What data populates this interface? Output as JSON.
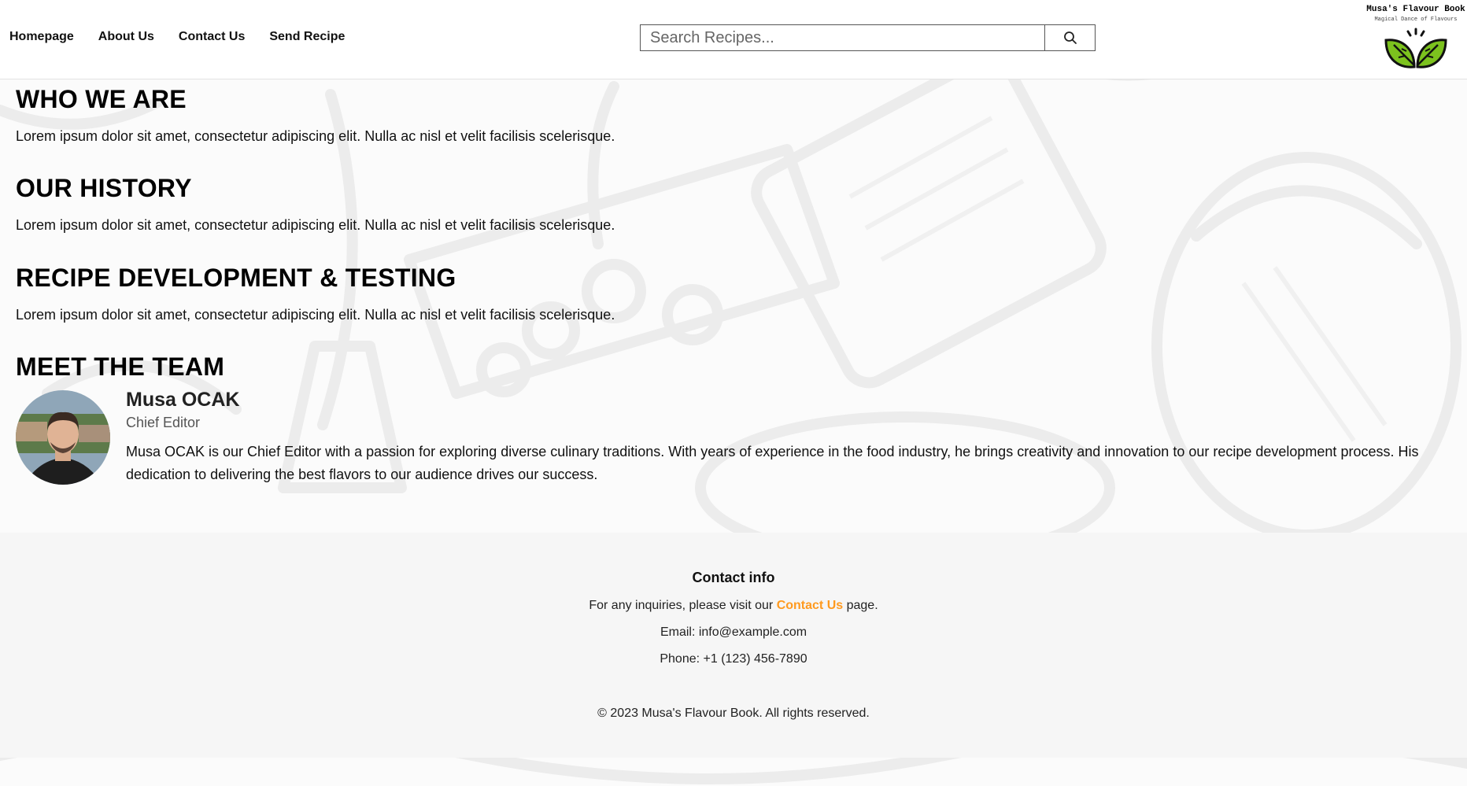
{
  "nav": {
    "items": [
      "Homepage",
      "About Us",
      "Contact Us",
      "Send Recipe"
    ]
  },
  "search": {
    "placeholder": "Search Recipes...",
    "icon": "search-icon"
  },
  "brand": {
    "title": "Musa's Flavour Book",
    "tagline": "Magical Dance of Flavours",
    "logo_icon": "leaf-logo-icon",
    "logo_color": "#7cc21e"
  },
  "sections": [
    {
      "heading": "WHO WE ARE",
      "body": "Lorem ipsum dolor sit amet, consectetur adipiscing elit. Nulla ac nisl et velit facilisis scelerisque."
    },
    {
      "heading": "OUR HISTORY",
      "body": "Lorem ipsum dolor sit amet, consectetur adipiscing elit. Nulla ac nisl et velit facilisis scelerisque."
    },
    {
      "heading": "RECIPE DEVELOPMENT & TESTING",
      "body": "Lorem ipsum dolor sit amet, consectetur adipiscing elit. Nulla ac nisl et velit facilisis scelerisque."
    }
  ],
  "team": {
    "heading": "MEET THE TEAM",
    "member": {
      "name": "Musa OCAK",
      "role": "Chief Editor",
      "bio": "Musa OCAK is our Chief Editor with a passion for exploring diverse culinary traditions. With years of experience in the food industry, he brings creativity and innovation to our recipe development process. His dedication to delivering the best flavors to our audience drives our success."
    }
  },
  "footer": {
    "heading": "Contact info",
    "inquiry_prefix": "For any inquiries, please visit our",
    "inquiry_link": "Contact Us",
    "inquiry_suffix": "page.",
    "email": "Email: info@example.com",
    "phone": "Phone: +1 (123) 456-7890",
    "copyright": "© 2023 Musa's Flavour Book. All rights reserved.",
    "link_color": "#ff9a1f"
  }
}
